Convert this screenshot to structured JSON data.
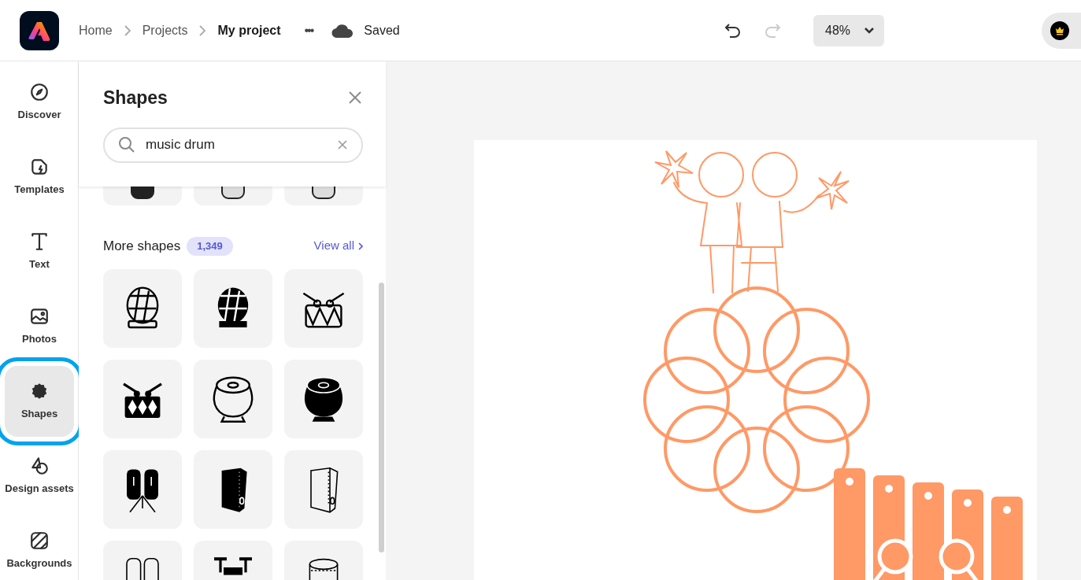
{
  "header": {
    "breadcrumbs": [
      {
        "label": "Home",
        "current": false
      },
      {
        "label": "Projects",
        "current": false
      },
      {
        "label": "My project",
        "current": true
      }
    ],
    "more": "•••",
    "save_status": "Saved",
    "undo": {
      "disabled": false
    },
    "redo": {
      "disabled": true
    },
    "zoom": "48%"
  },
  "sidebar": {
    "items": [
      {
        "label": "Discover",
        "kind": "discover",
        "selected": false
      },
      {
        "label": "Templates",
        "kind": "templates",
        "selected": false
      },
      {
        "label": "Text",
        "kind": "text",
        "selected": false
      },
      {
        "label": "Photos",
        "kind": "photos",
        "selected": false
      },
      {
        "label": "Shapes",
        "kind": "shapes",
        "selected": true
      },
      {
        "label": "Design assets",
        "kind": "assets",
        "selected": false
      },
      {
        "label": "Backgrounds",
        "kind": "backgrounds",
        "selected": false
      }
    ]
  },
  "panel": {
    "title": "Shapes",
    "search": {
      "value": "music drum"
    },
    "section": {
      "title": "More shapes",
      "count": "1,349",
      "link": "View all"
    }
  }
}
